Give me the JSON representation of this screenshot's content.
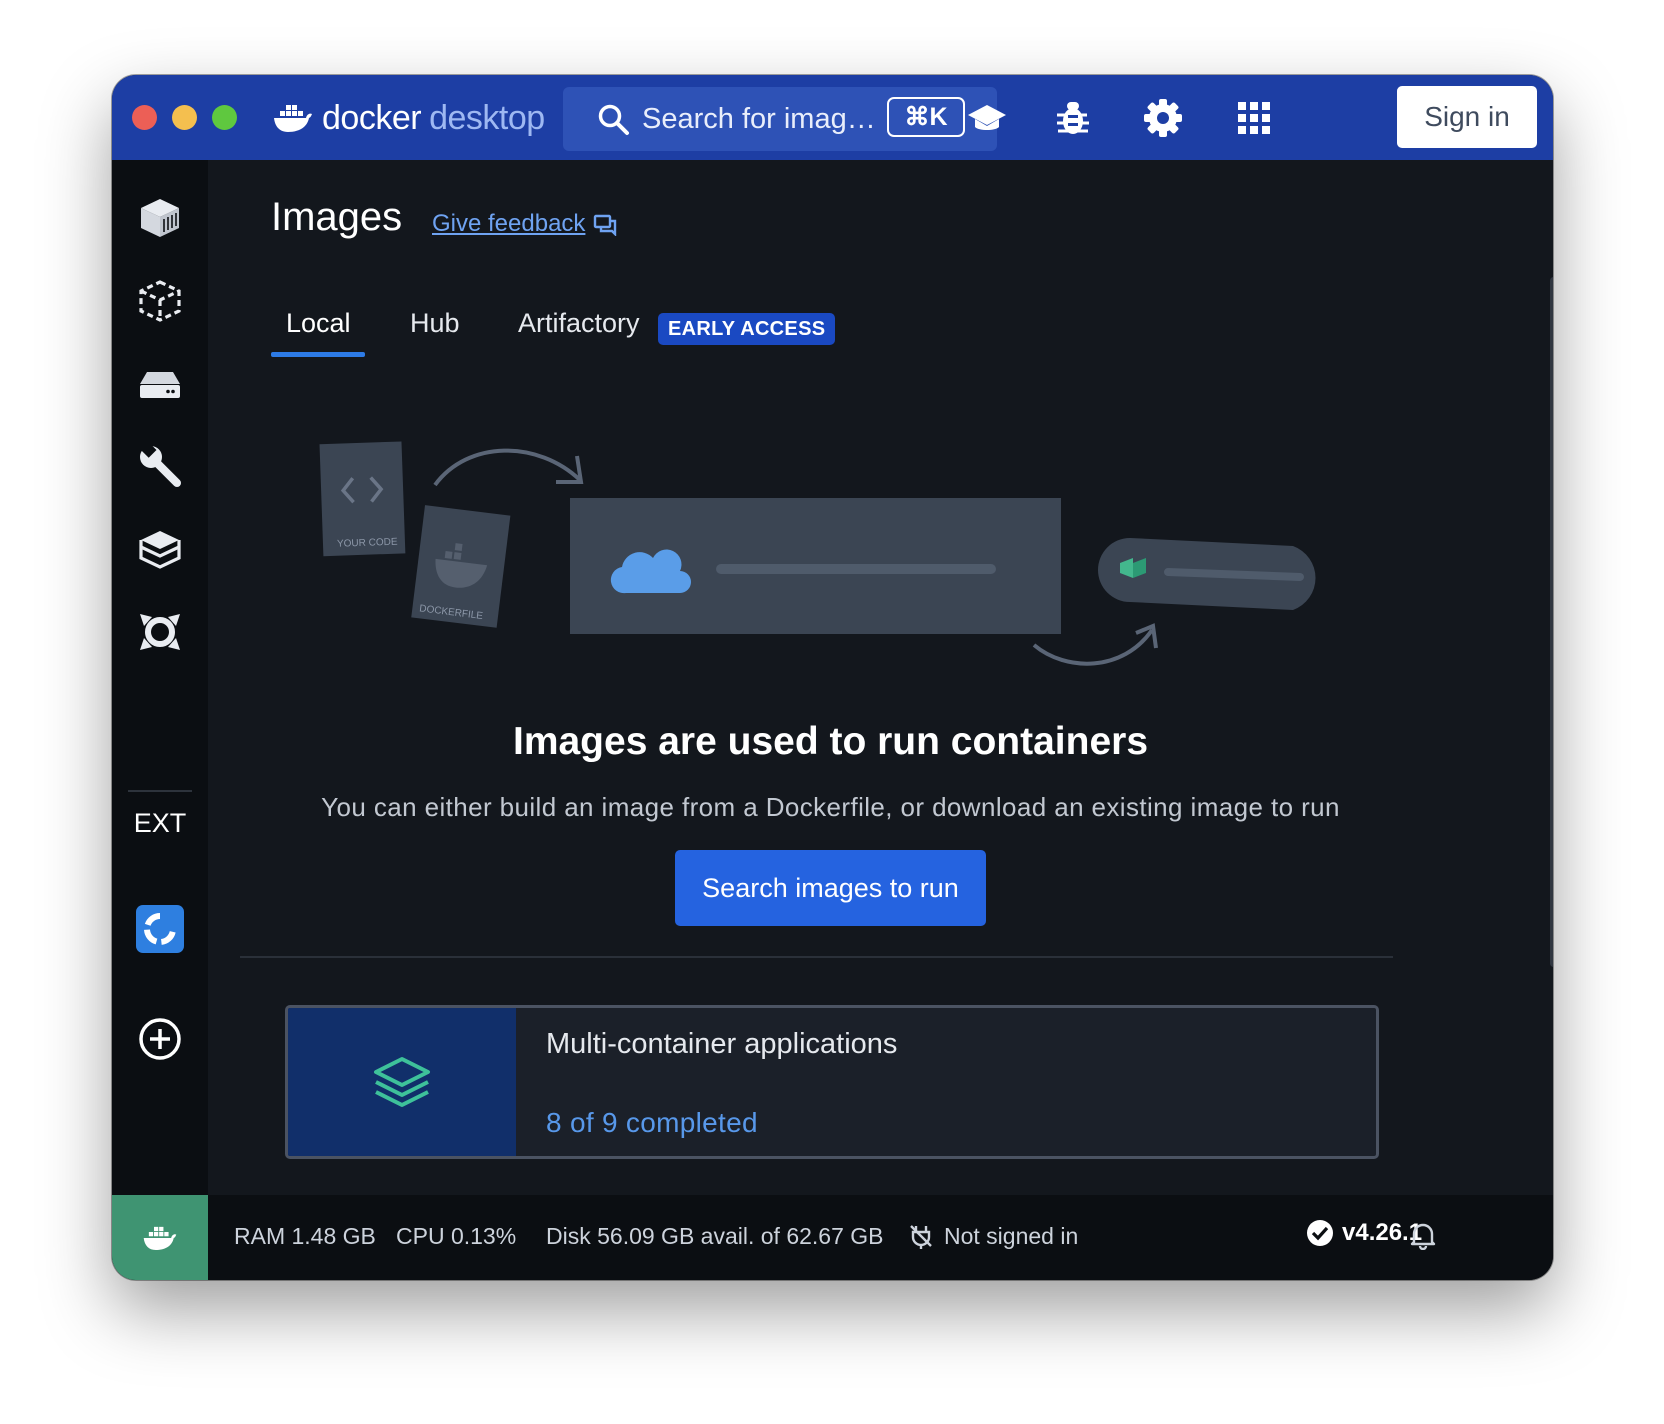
{
  "window": {
    "brand_word1": "docker",
    "brand_word2": "desktop"
  },
  "search": {
    "placeholder": "Search for imag…",
    "shortcut": "⌘K"
  },
  "toolbar": {
    "sign_in_label": "Sign in"
  },
  "sidebar": {
    "items": [
      {
        "icon": "containers-icon"
      },
      {
        "icon": "images-icon"
      },
      {
        "icon": "volumes-icon"
      },
      {
        "icon": "builds-icon"
      },
      {
        "icon": "dev-environments-icon"
      },
      {
        "icon": "docker-scout-icon"
      }
    ],
    "ext_label": "EXT"
  },
  "page": {
    "title": "Images",
    "feedback_label": "Give feedback",
    "tabs": [
      {
        "label": "Local",
        "active": true
      },
      {
        "label": "Hub",
        "active": false
      },
      {
        "label": "Artifactory",
        "active": false
      }
    ],
    "early_access_badge": "EARLY ACCESS"
  },
  "illustration": {
    "code_label": "YOUR CODE",
    "dockerfile_label": "DOCKERFILE"
  },
  "empty_state": {
    "heading": "Images are used to run containers",
    "subtext": "You can either build an image from a Dockerfile, or download an existing image to run",
    "button_label": "Search images to run"
  },
  "walkthrough": {
    "title": "Multi-container applications",
    "progress": "8 of 9 completed",
    "completed": 8,
    "total": 9
  },
  "status": {
    "ram": "RAM 1.48 GB",
    "cpu": "CPU 0.13%",
    "disk": "Disk 56.09 GB avail. of 62.67 GB",
    "sign_status": "Not signed in",
    "version": "v4.26.1"
  },
  "colors": {
    "titlebar": "#1d3ea4",
    "accent": "#2563e0",
    "link": "#6fa3f2",
    "engine_running": "#3f9472"
  }
}
